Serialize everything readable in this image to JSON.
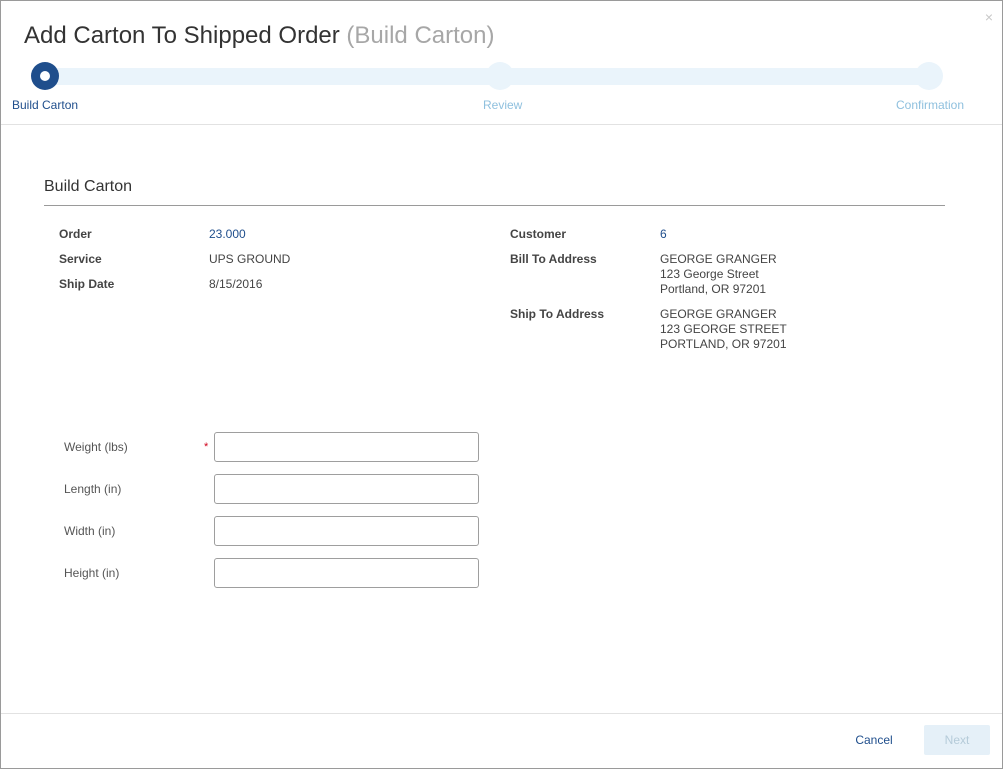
{
  "dialog": {
    "title": "Add Carton To Shipped Order",
    "subtitle": "(Build Carton)",
    "close_label": "×"
  },
  "stepper": {
    "steps": [
      {
        "label": "Build Carton",
        "state": "active"
      },
      {
        "label": "Review",
        "state": "inactive"
      },
      {
        "label": "Confirmation",
        "state": "inactive"
      }
    ]
  },
  "section": {
    "title": "Build Carton"
  },
  "details": {
    "left": [
      {
        "label": "Order",
        "value": "23.000",
        "is_link": true
      },
      {
        "label": "Service",
        "value": "UPS GROUND",
        "is_link": false
      },
      {
        "label": "Ship Date",
        "value": "8/15/2016",
        "is_link": false
      }
    ],
    "customer": {
      "label": "Customer",
      "value": "6"
    },
    "bill_to": {
      "label": "Bill To Address",
      "lines": [
        "GEORGE GRANGER",
        "123 George Street",
        "Portland, OR 97201"
      ]
    },
    "ship_to": {
      "label": "Ship To Address",
      "lines": [
        "GEORGE GRANGER",
        "123 GEORGE STREET",
        "PORTLAND, OR 97201"
      ]
    }
  },
  "form": {
    "required_marker": "*",
    "fields": [
      {
        "label": "Weight (lbs)",
        "value": "",
        "required": true
      },
      {
        "label": "Length (in)",
        "value": "",
        "required": false
      },
      {
        "label": "Width (in)",
        "value": "",
        "required": false
      },
      {
        "label": "Height (in)",
        "value": "",
        "required": false
      }
    ]
  },
  "footer": {
    "cancel_label": "Cancel",
    "next_label": "Next",
    "next_enabled": false
  },
  "colors": {
    "primary": "#1f4e8c",
    "step_inactive": "#8fc0de",
    "track": "#eaf4fb",
    "required": "#d0021b"
  }
}
